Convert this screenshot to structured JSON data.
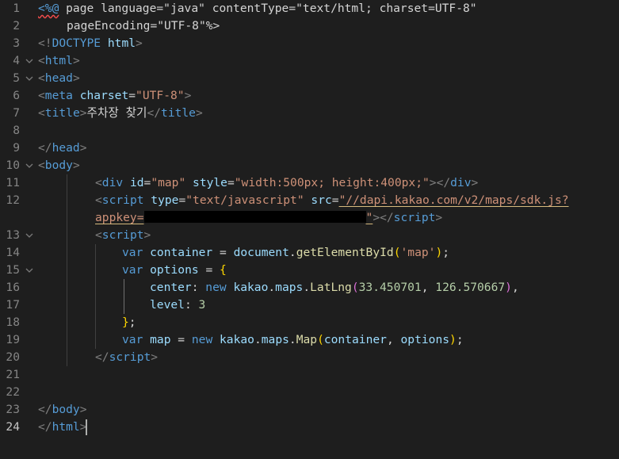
{
  "editor": {
    "language": "jsp",
    "active_line": 24,
    "colors": {
      "background": "#1e1e1e",
      "keyword": "#569cd6",
      "attribute": "#9cdcfe",
      "string": "#ce9178",
      "function": "#dcdcaa",
      "number": "#b5cea8",
      "bracket": "#ffd700",
      "line_number": "#858585"
    },
    "lines": [
      {
        "n": "1",
        "fold": false
      },
      {
        "n": "2",
        "fold": false
      },
      {
        "n": "3",
        "fold": false
      },
      {
        "n": "4",
        "fold": true
      },
      {
        "n": "5",
        "fold": true
      },
      {
        "n": "6",
        "fold": false
      },
      {
        "n": "7",
        "fold": false
      },
      {
        "n": "8",
        "fold": false
      },
      {
        "n": "9",
        "fold": false
      },
      {
        "n": "10",
        "fold": true
      },
      {
        "n": "11",
        "fold": false
      },
      {
        "n": "12",
        "fold": false
      },
      {
        "n": "13",
        "fold": true
      },
      {
        "n": "14",
        "fold": false
      },
      {
        "n": "15",
        "fold": true
      },
      {
        "n": "16",
        "fold": false
      },
      {
        "n": "17",
        "fold": false
      },
      {
        "n": "18",
        "fold": false
      },
      {
        "n": "19",
        "fold": false
      },
      {
        "n": "20",
        "fold": false
      },
      {
        "n": "21",
        "fold": false
      },
      {
        "n": "22",
        "fold": false
      },
      {
        "n": "23",
        "fold": false
      },
      {
        "n": "24",
        "fold": false
      }
    ],
    "code": {
      "l1_a": "<%@",
      "l1_b": " page ",
      "l1_c": "language",
      "l1_d": "=",
      "l1_e": "\"java\"",
      "l1_f": " ",
      "l1_g": "contentType",
      "l1_h": "=",
      "l1_i": "\"text/html; charset=UTF-8\"",
      "l2_a": "pageEncoding",
      "l2_b": "=",
      "l2_c": "\"UTF-8\"",
      "l2_d": "%>",
      "l3_a": "<!",
      "l3_b": "DOCTYPE",
      "l3_c": " html",
      "l3_d": ">",
      "l4_a": "<",
      "l4_b": "html",
      "l4_c": ">",
      "l5_a": "<",
      "l5_b": "head",
      "l5_c": ">",
      "l6_a": "<",
      "l6_b": "meta",
      "l6_c": " charset",
      "l6_d": "=",
      "l6_e": "\"UTF-8\"",
      "l6_f": ">",
      "l7_a": "<",
      "l7_b": "title",
      "l7_c": ">",
      "l7_d": "주차장 찾기",
      "l7_e": "</",
      "l7_f": "title",
      "l7_g": ">",
      "l9_a": "</",
      "l9_b": "head",
      "l9_c": ">",
      "l10_a": "<",
      "l10_b": "body",
      "l10_c": ">",
      "l11_a": "<",
      "l11_b": "div",
      "l11_c": " id",
      "l11_d": "=",
      "l11_e": "\"map\"",
      "l11_f": " style",
      "l11_g": "=",
      "l11_h": "\"width:500px; height:400px;\"",
      "l11_i": "></",
      "l11_j": "div",
      "l11_k": ">",
      "l12_a": "<",
      "l12_b": "script",
      "l12_c": " type",
      "l12_d": "=",
      "l12_e": "\"text/javascript\"",
      "l12_f": " src",
      "l12_g": "=",
      "l12_h": "\"//dapi.kakao.com/v2/maps/sdk.js?",
      "l12w_a": "appkey=",
      "l12w_b": "\"",
      "l12w_c": "></",
      "l12w_d": "script",
      "l12w_e": ">",
      "l13_a": "<",
      "l13_b": "script",
      "l13_c": ">",
      "l14_a": "var",
      "l14_b": " container",
      "l14_c": " = ",
      "l14_d": "document",
      "l14_e": ".",
      "l14_f": "getElementById",
      "l14_g": "(",
      "l14_h": "'map'",
      "l14_i": ")",
      "l14_j": ";",
      "l15_a": "var",
      "l15_b": " options",
      "l15_c": " = ",
      "l15_d": "{",
      "l16_a": "center",
      "l16_b": ": ",
      "l16_c": "new",
      "l16_d": " kakao",
      "l16_e": ".",
      "l16_f": "maps",
      "l16_g": ".",
      "l16_h": "LatLng",
      "l16_i": "(",
      "l16_j": "33.450701",
      "l16_k": ", ",
      "l16_l": "126.570667",
      "l16_m": ")",
      "l16_n": ",",
      "l17_a": "level",
      "l17_b": ": ",
      "l17_c": "3",
      "l18_a": "}",
      "l18_b": ";",
      "l19_a": "var",
      "l19_b": " map",
      "l19_c": " = ",
      "l19_d": "new",
      "l19_e": " kakao",
      "l19_f": ".",
      "l19_g": "maps",
      "l19_h": ".",
      "l19_i": "Map",
      "l19_j": "(",
      "l19_k": "container",
      "l19_l": ", ",
      "l19_m": "options",
      "l19_n": ")",
      "l19_o": ";",
      "l20_a": "</",
      "l20_b": "script",
      "l20_c": ">",
      "l23_a": "</",
      "l23_b": "body",
      "l23_c": ">",
      "l24_a": "</",
      "l24_b": "html",
      "l24_c": ">"
    }
  }
}
